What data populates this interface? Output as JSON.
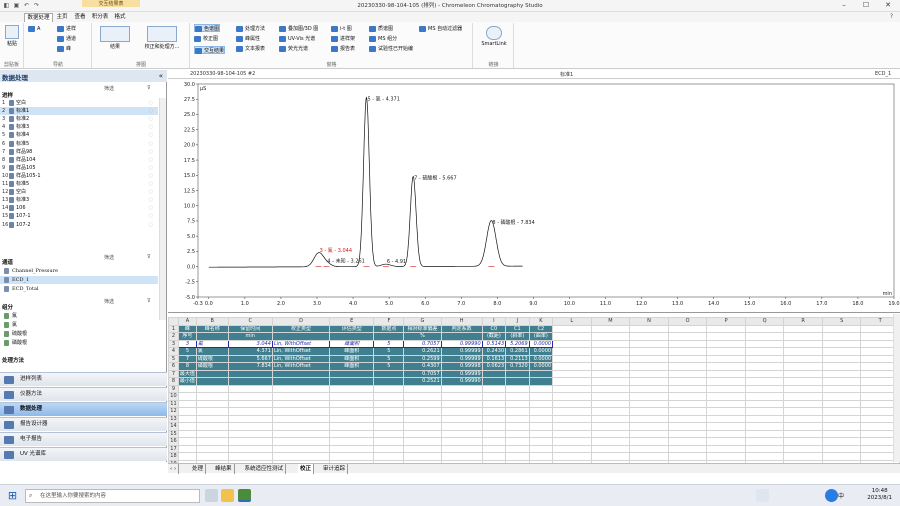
{
  "window": {
    "title": "20230330-98-104-105 (排列) - Chromeleon Chromatography Studio",
    "context_tab": "交互结果表"
  },
  "tabs": [
    "数据处理",
    "主页",
    "查看",
    "积分表",
    "格式"
  ],
  "ribbon": {
    "groups": [
      "剪贴板",
      "导航",
      "排图",
      "窗格",
      "链接"
    ],
    "paste": "粘贴",
    "nav": [
      "进样",
      "通道",
      "峰"
    ],
    "layout": [
      "结果",
      "校正和处理方..."
    ],
    "pane_items": [
      [
        "色谱图",
        "处理方法",
        "叠加图/3D 图",
        "i-t 图",
        "质谱图",
        "MS 自动过滤器"
      ],
      [
        "校正图",
        "峰属性",
        "UV-Vis 光谱",
        "进样架",
        "MS 组分"
      ],
      [
        "交互结果",
        "文本报表",
        "荧光光谱",
        "报告表",
        "试验性已开始编"
      ]
    ],
    "smartlink": "SmartLink"
  },
  "left": {
    "title": "数据处理",
    "filter": "筛选",
    "injections_label": "进样",
    "injections": [
      {
        "n": "1",
        "name": "空白"
      },
      {
        "n": "2",
        "name": "标准1"
      },
      {
        "n": "3",
        "name": "标准2"
      },
      {
        "n": "4",
        "name": "标准3"
      },
      {
        "n": "5",
        "name": "标准4"
      },
      {
        "n": "6",
        "name": "标准5"
      },
      {
        "n": "7",
        "name": "样品98"
      },
      {
        "n": "8",
        "name": "样品104"
      },
      {
        "n": "9",
        "name": "样品105"
      },
      {
        "n": "10",
        "name": "样品105-1"
      },
      {
        "n": "11",
        "name": "标准5"
      },
      {
        "n": "12",
        "name": "空白"
      },
      {
        "n": "13",
        "name": "标准3"
      },
      {
        "n": "14",
        "name": "106"
      },
      {
        "n": "15",
        "name": "107-1"
      },
      {
        "n": "16",
        "name": "107-2"
      }
    ],
    "channels_label": "通道",
    "channels": [
      "Channel_Pressure",
      "ECD_1",
      "ECD_Total"
    ],
    "components_label": "组分",
    "components": [
      "氟",
      "氯",
      "硫酸根",
      "磷酸根"
    ],
    "process_label": "处理方法",
    "nav": [
      "进样列表",
      "仪器方法",
      "数据处理",
      "报告设计器",
      "电子报告",
      "UV 光谱库"
    ]
  },
  "chart": {
    "header_left": "20230330-98-104-105 #2",
    "header_mid": "标准1",
    "header_right": "ECD_1",
    "yunit": "µS",
    "xunit": "min",
    "peaks": [
      {
        "label": "3 - 氟 - 3.044",
        "t": 3.044,
        "h": 2.2,
        "color": "#d02020"
      },
      {
        "label": "4 - 未知 - 3.261",
        "t": 3.261,
        "h": 0.5,
        "color": "#222"
      },
      {
        "label": "5 - 氯 - 4.371",
        "t": 4.371,
        "h": 27.8,
        "color": "#222"
      },
      {
        "label": "6 - 4.91",
        "t": 4.91,
        "h": 0.4,
        "color": "#222"
      },
      {
        "label": "7 - 硫酸根 - 5.667",
        "t": 5.667,
        "h": 14.8,
        "color": "#222"
      },
      {
        "label": "8 - 磷酸根 - 7.834",
        "t": 7.834,
        "h": 7.5,
        "color": "#222"
      }
    ],
    "yticks": [
      "30.0",
      "27.5",
      "25.0",
      "22.5",
      "20.0",
      "17.5",
      "15.0",
      "12.5",
      "10.0",
      "7.5",
      "5.0",
      "2.5",
      "0.0",
      "-2.5",
      "-5.0"
    ],
    "xticks": [
      "-0.3",
      "0.0",
      "1.0",
      "2.0",
      "3.0",
      "4.0",
      "5.0",
      "6.0",
      "7.0",
      "8.0",
      "9.0",
      "10.0",
      "11.0",
      "12.0",
      "13.0",
      "14.0",
      "15.0",
      "16.0",
      "17.0",
      "18.0",
      "19.0"
    ]
  },
  "grid": {
    "cols": [
      "A",
      "B",
      "C",
      "D",
      "E",
      "F",
      "G",
      "H",
      "I",
      "J",
      "K",
      "L",
      "M",
      "N",
      "O",
      "P",
      "Q",
      "R",
      "S",
      "T"
    ],
    "header1": [
      "峰",
      "峰名称",
      "保留时间",
      "校正类型",
      "评估类型",
      "数据点",
      "相对标准偏差",
      "判定系数",
      "C0",
      "C1",
      "C2"
    ],
    "header2": [
      "序号",
      "",
      "min",
      "",
      "",
      "",
      "%",
      "",
      "(截距)",
      "(斜率)",
      "(曲率)"
    ],
    "rows": [
      [
        "3",
        "氟",
        "3.044",
        "Lin, WithOffset",
        "峰面积",
        "5",
        "0.7057",
        "0.99990",
        "0.5143",
        "5.2069",
        "0.0000"
      ],
      [
        "5",
        "氯",
        "4.371",
        "Lin, WithOffset",
        "峰面积",
        "5",
        "0.2621",
        "0.99999",
        "0.2430",
        "0.2861",
        "0.0000"
      ],
      [
        "7",
        "硫酸根",
        "5.667",
        "Lin, WithOffset",
        "峰面积",
        "5",
        "0.2599",
        "0.99999",
        "0.1613",
        "0.2113",
        "0.0000"
      ],
      [
        "8",
        "磷酸根",
        "7.834",
        "Lin, WithOffset",
        "峰面积",
        "5",
        "0.4307",
        "0.99998",
        "0.0623",
        "0.7320",
        "0.0000"
      ]
    ],
    "max": [
      "最大值",
      "0.7057",
      "0.99999"
    ],
    "min": [
      "最小值",
      "0.2521",
      "0.99990"
    ],
    "sheets": [
      "处理",
      "峰结果",
      "系统适应性测试",
      "校正",
      "审计追踪"
    ]
  },
  "taskbar": {
    "search": "在这里输入你要搜索的内容",
    "time": "10:48",
    "date": "2023/8/1",
    "lang": "中"
  },
  "watermark": "仪器信息网"
}
